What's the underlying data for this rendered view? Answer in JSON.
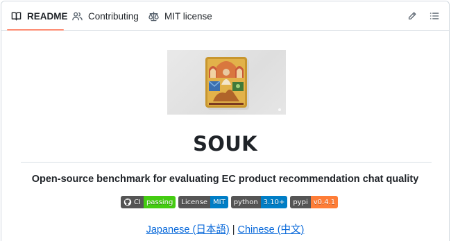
{
  "tabs": {
    "readme": "README",
    "contributing": "Contributing",
    "license": "MIT license"
  },
  "readme": {
    "title": "SOUK",
    "subtitle": "Open-source benchmark for evaluating EC product recommendation chat quality",
    "badges": [
      {
        "label": "CI",
        "message": "passing",
        "color": "#4c1"
      },
      {
        "label": "License",
        "message": "MIT",
        "color": "#007ec6"
      },
      {
        "label": "python",
        "message": "3.10+",
        "color": "#007ec6"
      },
      {
        "label": "pypi",
        "message": "v0.4.1",
        "color": "#fe7d37"
      }
    ],
    "languages": {
      "japanese": "Japanese (日本語)",
      "separator": " | ",
      "chinese": "Chinese (中文)"
    }
  },
  "icons": {
    "readme": "book-icon",
    "contributing": "people-icon",
    "license": "law-scale-icon",
    "edit": "pencil-icon",
    "outline": "list-icon"
  },
  "colors": {
    "active_tab_underline": "#fd8c73",
    "link": "#0969da"
  }
}
